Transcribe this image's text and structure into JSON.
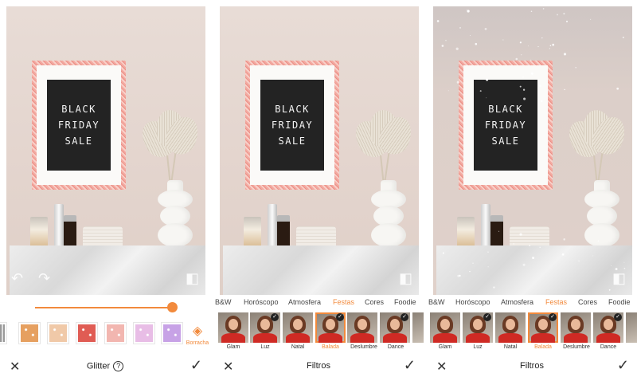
{
  "board_text": [
    "BLACK",
    "FRIDAY",
    "SALE"
  ],
  "glitter_panel": {
    "title": "Glitter",
    "eraser_label": "Borracha",
    "slider_value_percent": 95,
    "swatch_colors": [
      "#e6a060",
      "#f0c9a8",
      "#e05c54",
      "#f2b6b0",
      "#e8bde6",
      "#c7a2e6"
    ]
  },
  "filter_panel_1": {
    "title": "Filtros",
    "tabs": [
      "B&W",
      "Horóscopo",
      "Atmosfera",
      "Festas",
      "Cores",
      "Foodie"
    ],
    "active_tab": "Festas",
    "filters": [
      "Glam",
      "Luz",
      "Natal",
      "Balada",
      "Deslumbre",
      "Dance"
    ],
    "selected_filter": "Balada"
  },
  "filter_panel_2": {
    "title": "Filtros",
    "tabs": [
      "B&W",
      "Horóscopo",
      "Atmosfera",
      "Festas",
      "Cores",
      "Foodie"
    ],
    "active_tab": "Festas",
    "filters": [
      "Glam",
      "Luz",
      "Natal",
      "Balada",
      "Deslumbre",
      "Dance"
    ],
    "selected_filter": "Balada"
  },
  "icons": {
    "cancel": "✕",
    "confirm": "✓",
    "undo": "↶",
    "redo": "↷",
    "compare": "◧",
    "help": "?",
    "eraser": "◈",
    "check": "✓"
  },
  "colors": {
    "accent": "#f28a3c"
  }
}
